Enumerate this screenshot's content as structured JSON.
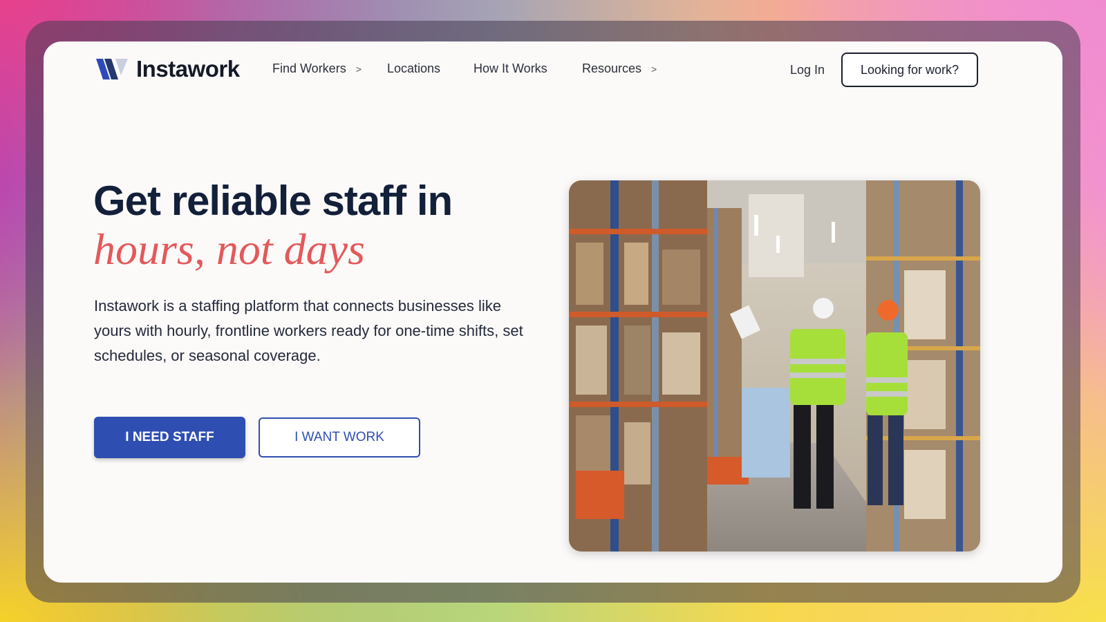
{
  "brand": {
    "name": "Instawork",
    "colors": {
      "navy": "#13203a",
      "accent": "#e3595a",
      "primary": "#2e4eb2"
    }
  },
  "nav": {
    "items": [
      {
        "label": "Find Workers",
        "chevron": ">"
      },
      {
        "label": "Locations"
      },
      {
        "label": "How It Works"
      },
      {
        "label": "Resources",
        "chevron": ">"
      }
    ],
    "login": "Log In",
    "cta": "Looking for work?"
  },
  "hero": {
    "headline": "Get reliable staff in",
    "headline_accent": "hours, not days",
    "description": "Instawork is a staffing platform that connects businesses like yours with hourly, frontline workers ready for one-time shifts, set schedules, or seasonal coverage.",
    "primary_button": "I NEED STAFF",
    "secondary_button": "I WANT WORK",
    "image": {
      "subject": "warehouse-workers-photo"
    }
  }
}
